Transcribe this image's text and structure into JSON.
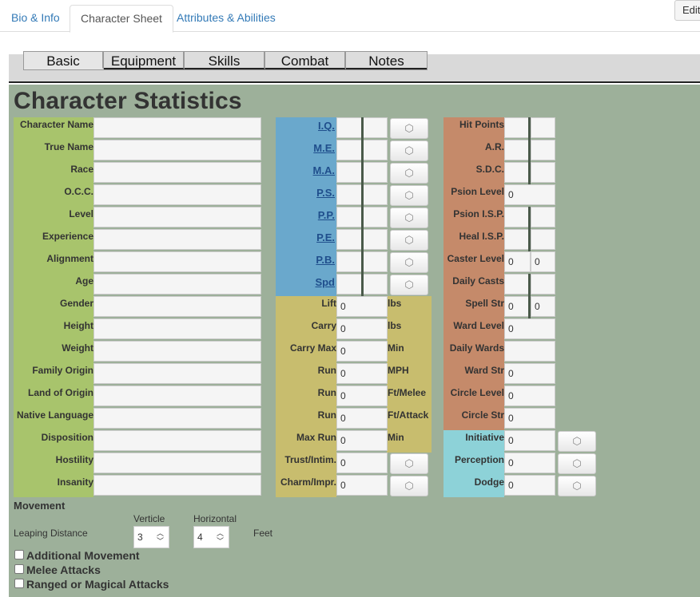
{
  "top_tabs": {
    "bio": "Bio & Info",
    "sheet": "Character Sheet",
    "attrs": "Attributes & Abilities"
  },
  "edit_label": "Edit",
  "sub_tabs": [
    "Basic",
    "Equipment",
    "Skills",
    "Combat",
    "Notes"
  ],
  "title": "Character Statistics",
  "bio_fields": [
    "Character Name",
    "True Name",
    "Race",
    "O.C.C.",
    "Level",
    "Experience",
    "Alignment",
    "Age",
    "Gender",
    "Height",
    "Weight",
    "Family Origin",
    "Land of Origin",
    "Native Language",
    "Disposition",
    "Hostility",
    "Insanity"
  ],
  "attributes": [
    "I.Q.",
    "M.E.",
    "M.A.",
    "P.S.",
    "P.P.",
    "P.E.",
    "P.B.",
    "Spd"
  ],
  "physical": [
    {
      "label": "Lift",
      "value": "0",
      "unit": "lbs"
    },
    {
      "label": "Carry",
      "value": "0",
      "unit": "lbs"
    },
    {
      "label": "Carry Max",
      "value": "0",
      "unit": "Min"
    },
    {
      "label": "Run",
      "value": "0",
      "unit": "MPH"
    },
    {
      "label": "Run",
      "value": "0",
      "unit": "Ft/Melee"
    },
    {
      "label": "Run",
      "value": "0",
      "unit": "Ft/Attack"
    },
    {
      "label": "Max Run",
      "value": "0",
      "unit": "Min"
    }
  ],
  "social": [
    {
      "label": "Trust/Intim.",
      "value": "0"
    },
    {
      "label": "Charm/Impr.",
      "value": "0"
    }
  ],
  "stats": [
    {
      "label": "Hit Points",
      "v1": "",
      "v2": ""
    },
    {
      "label": "A.R.",
      "v1": "",
      "v2": ""
    },
    {
      "label": "S.D.C.",
      "v1": "",
      "v2": ""
    },
    {
      "label": "Psion Level",
      "v1": "0"
    },
    {
      "label": "Psion I.S.P.",
      "v1": "",
      "v2": ""
    },
    {
      "label": "Heal I.S.P.",
      "v1": "",
      "v2": ""
    },
    {
      "label": "Caster Level",
      "v1": "0",
      "v2": "0"
    },
    {
      "label": "Daily Casts",
      "v1": "",
      "v2": ""
    },
    {
      "label": "Spell Str",
      "v1": "0",
      "v2": "0"
    },
    {
      "label": "Ward Level",
      "v1": "0"
    },
    {
      "label": "Daily Wards",
      "v1": ""
    },
    {
      "label": "Ward Str",
      "v1": "0"
    },
    {
      "label": "Circle Level",
      "v1": "0"
    },
    {
      "label": "Circle Str",
      "v1": "0"
    }
  ],
  "combat": [
    {
      "label": "Initiative",
      "value": "0"
    },
    {
      "label": "Perception",
      "value": "0"
    },
    {
      "label": "Dodge",
      "value": "0"
    }
  ],
  "movement": {
    "heading": "Movement",
    "vert_label": "Verticle",
    "horiz_label": "Horizontal",
    "leap_label": "Leaping Distance",
    "vert_value": "3",
    "horiz_value": "4",
    "unit": "Feet"
  },
  "checkboxes": [
    "Additional Movement",
    "Melee Attacks",
    "Ranged or Magical Attacks"
  ],
  "dice_icon": "d20-dice-icon",
  "colors": {
    "bio": "#a8c46c",
    "attr": "#6aa8cc",
    "phys": "#c8bd6e",
    "stats": "#c58a6a",
    "combat": "#8dd2d8",
    "sheet": "#9db09a"
  }
}
